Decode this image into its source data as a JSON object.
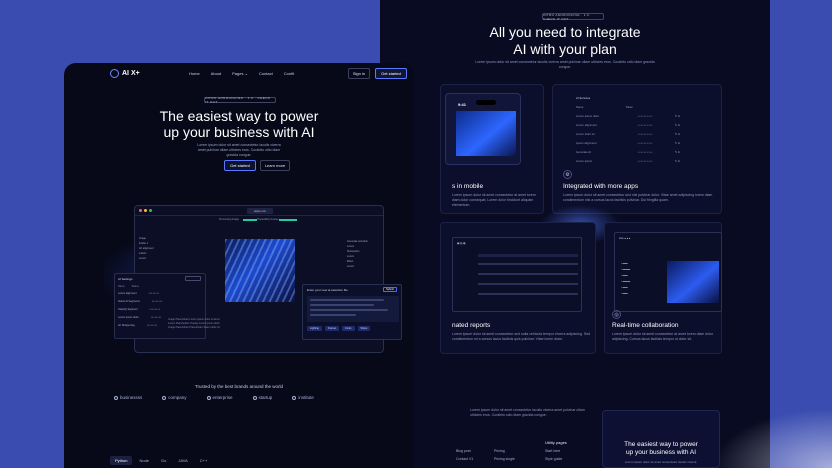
{
  "left": {
    "logo": "AI X+",
    "nav": [
      "Home",
      "About",
      "Pages",
      "Contact",
      "Confit"
    ],
    "sign_in": "Sign in",
    "get_started": "Get started",
    "pill": "INTRO ANNOUNCING · 1.0 · CHECK IT OUT",
    "hero_title_1": "The easiest way to power",
    "hero_title_2": "up your business with AI",
    "hero_sub": "Lorem ipsum dolor sit amet consectetur iaculis viverra amet pulvinar ullam ultricies eros. Curabitu odio diam gravida congue.",
    "btn_primary": "Get started",
    "btn_secondary": "Learn more",
    "app": {
      "url": "aiplus.com",
      "progress_label": "Processing image",
      "progress_done": "Traceability cleaner",
      "side_items": [
        "Image",
        "Folder 1",
        "Art alignment",
        "Labels",
        "Lorem"
      ],
      "right_items": [
        "Generate selection",
        "Lorem",
        "Subsection",
        "Lorem",
        "Effect",
        "Lorem"
      ],
      "settings_title": "AI Settings",
      "settings_head": [
        "Name",
        "Status"
      ],
      "settings_rows": [
        "Lorem alignment",
        "Select AI Segments",
        "Classify Segment",
        "Lorem ipsum dolor",
        "Art Sharpening"
      ],
      "chat_title": "Enter your new ai selection file",
      "chat_btn": "Submit",
      "chat_tags": [
        "Lighting",
        "Frames",
        "Fonts",
        "Styles"
      ],
      "bottom_lines": [
        "Image Placeholder Lorem ipsum dolor sit amet",
        "Lorem Placeholder Overlay Lorem ipsum dolor",
        "Image Placeholder Placeholder Select dolor sit"
      ]
    },
    "trusted": "Trusted by the best brands around the world",
    "brands": [
      "businessss",
      "company",
      "enterprise",
      "startup",
      "institute"
    ],
    "tabs": [
      "Python",
      "Node",
      "Go",
      "JAVA",
      "C++"
    ]
  },
  "right": {
    "pill": "INTRO ANNOUNCING · 1.0 · CHECK IT OUT",
    "title_1": "All you need to integrate",
    "title_2": "AI with your plan",
    "sub": "Lorem ipsum dolor sit amet consectetur iaculis viverra amet pulvinar ullam ultricies eros. Curabitu odio diam gravida congue.",
    "card1_title": "s in mobile",
    "card1_text": "Lorem ipsum dolor sit amet consectetur at amet lorem diam dolor consequat. Lorem dolor tincidunt aliquam elementum.",
    "phone_time": "9:41",
    "card2_title": "Integrated with more apps",
    "card2_text": "Lorem ipsum dolor sit amet consectetur sed nisl pulvinar dolor. Vitae amet adipiscing lorem diam condimentum nisi a cursus lacus facilisis pulvinar. Dui fringilla quam.",
    "card2_table_title": "AI Services",
    "card2_table_head": [
      "Name",
      "Token"
    ],
    "card2_table_rows": [
      "Lorem ipsum dolor",
      "Lorem alignment",
      "Lorem dolor sit",
      "Ipsum alignment",
      "Generate AI",
      "Lorem ipsum"
    ],
    "card3_title": "nated reports",
    "card3_text": "Lorem ipsum dolor sit amet consectetur sed nulla vehicula tempor viverra adipiscing. Sed condimentum mi a cursus lacus facilisis quis pulvinar. Vitae lorem diam.",
    "card4_title": "Real-time collaboration",
    "card4_text": "Lorem ipsum dolor sit amet consectetur at amet lorem diam dolor adipiscing. Cursus lacus facilisis tempor ut dolor sit.",
    "footer_text": "Lorem ipsum dolor sit amet consectetur iaculis viverra amet pulvinar ullam ultricies eros. Curabitu odio diam gravida congue.",
    "footer_cols": [
      {
        "head": "",
        "items": [
          "Blog post",
          "Contact V1"
        ]
      },
      {
        "head": "",
        "items": [
          "Pricing",
          "Pricing single"
        ]
      },
      {
        "head": "Utility pages",
        "items": [
          "Start here",
          "Style guide"
        ]
      }
    ],
    "cta_title_1": "The easiest way to power",
    "cta_title_2": "up your business with AI",
    "cta_sub": "Lorem ipsum dolor sit amet consectetur iaculis viverra."
  }
}
